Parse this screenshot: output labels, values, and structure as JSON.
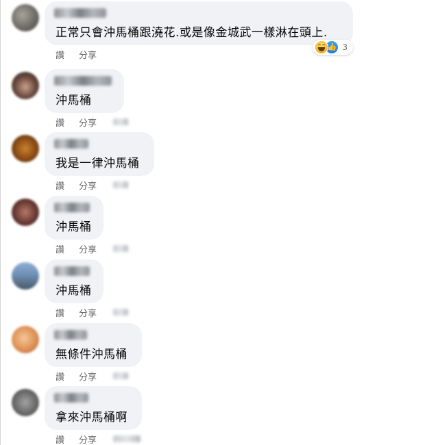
{
  "comments": [
    {
      "text": "正常只會沖馬桶跟澆花.或是像金城武一樣淋在頭上.",
      "actions": {
        "like": "讚",
        "share": "分享"
      },
      "reactions": {
        "icons": [
          "haha-icon",
          "like-icon"
        ],
        "count": "3"
      }
    },
    {
      "text": "沖馬桶",
      "actions": {
        "like": "讚",
        "share": "分享"
      }
    },
    {
      "text": "我是一律沖馬桶",
      "actions": {
        "like": "讚",
        "share": "分享"
      }
    },
    {
      "text": "沖馬桶",
      "actions": {
        "like": "讚",
        "share": "分享"
      }
    },
    {
      "text": "沖馬桶",
      "actions": {
        "like": "讚",
        "share": "分享"
      }
    },
    {
      "text": "無條件沖馬桶",
      "actions": {
        "like": "讚",
        "share": "分享"
      }
    },
    {
      "text": "拿來沖馬桶啊",
      "actions": {
        "like": "讚",
        "share": "分享"
      }
    }
  ],
  "colors": {
    "bubble": "#f0f2f5",
    "text": "#050505",
    "action_text": "#65676b",
    "like_blue": "#1877f2",
    "haha_yellow": "#f7b125"
  }
}
